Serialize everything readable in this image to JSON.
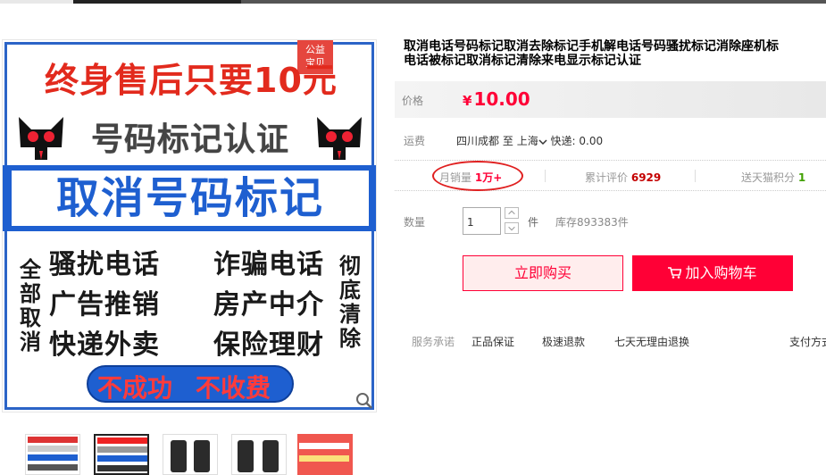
{
  "product": {
    "title_line1": "取消电话号码标记取消去除标记手机解电话号码骚扰标记消除座机标",
    "title_line2": "电话被标记取消标记清除来电显示标记认证"
  },
  "image": {
    "badge_line1": "公益",
    "badge_line2": "宝贝",
    "headline": "终身售后只要10元",
    "subhead": "号码标记认证",
    "banner": "取消号码标记",
    "left_vertical": "全部取消",
    "right_vertical": "彻底清除",
    "items": [
      "骚扰电话",
      "诈骗电话",
      "广告推销",
      "房产中介",
      "快递外卖",
      "保险理财"
    ],
    "pill_left": "不成功",
    "pill_right": "不收费"
  },
  "price": {
    "label": "价格",
    "currency": "¥",
    "value": "10.00"
  },
  "shipping": {
    "label": "运费",
    "from": "四川成都",
    "to_prefix": "至",
    "to": "上海",
    "express": "快递: 0.00"
  },
  "stats": {
    "sales_label": "月销量",
    "sales_value": "1万+",
    "reviews_label": "累计评价",
    "reviews_value": "6929",
    "points_label": "送天猫积分",
    "points_value": "1"
  },
  "quantity": {
    "label": "数量",
    "value": "1",
    "unit": "件",
    "stock": "库存893383件"
  },
  "buttons": {
    "buy": "立即购买",
    "cart": "加入购物车"
  },
  "services": {
    "label": "服务承诺",
    "items": [
      "正品保证",
      "极速退款",
      "七天无理由退换",
      "支付方式"
    ]
  },
  "thumbnails": {
    "count": 5,
    "active_index": 1
  },
  "colors": {
    "accent": "#ff0036",
    "banner_blue": "#1e5fd0",
    "headline_red": "#e22a1d"
  }
}
